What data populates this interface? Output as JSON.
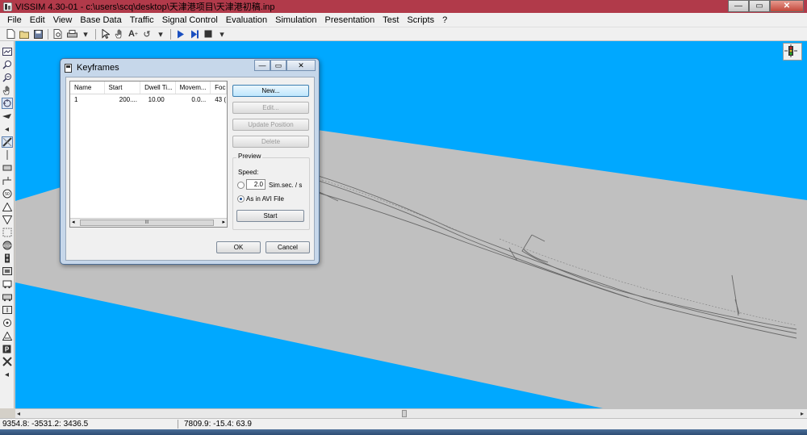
{
  "window": {
    "title": "VISSIM 4.30-01 - c:\\users\\scq\\desktop\\天津港项目\\天津港初稿.inp",
    "minimize": "—",
    "maximize": "▭",
    "close": "✕"
  },
  "menu": {
    "items": [
      {
        "label": "File",
        "enabled": true
      },
      {
        "label": "Edit",
        "enabled": true
      },
      {
        "label": "View",
        "enabled": true
      },
      {
        "label": "Base Data",
        "enabled": true
      },
      {
        "label": "Traffic",
        "enabled": true
      },
      {
        "label": "Signal Control",
        "enabled": true
      },
      {
        "label": "Evaluation",
        "enabled": true
      },
      {
        "label": "Simulation",
        "enabled": true
      },
      {
        "label": "Presentation",
        "enabled": true
      },
      {
        "label": "Test",
        "enabled": true
      },
      {
        "label": "Scripts",
        "enabled": true
      },
      {
        "label": "?",
        "enabled": true
      }
    ]
  },
  "toolbar": {
    "icons": [
      "new-file-icon",
      "open-file-icon",
      "save-icon",
      "print-preview-icon",
      "print-icon",
      "select-arrow-icon",
      "pan-hand-icon",
      "text-size-icon",
      "rotate-icon",
      "play-icon",
      "step-icon",
      "stop-icon"
    ]
  },
  "dialog": {
    "title": "Keyframes",
    "columns": [
      "Name",
      "Start",
      "Dwell Ti...",
      "Movem...",
      "Foc"
    ],
    "rows": [
      [
        "1",
        "200....",
        "10.00",
        "0.0...",
        "43 ("
      ]
    ],
    "buttons": {
      "new": "New...",
      "edit": "Edit...",
      "update_position": "Update Position",
      "delete": "Delete",
      "start": "Start",
      "ok": "OK",
      "cancel": "Cancel"
    },
    "preview": {
      "label": "Preview",
      "speed_label": "Speed:",
      "speed_value": "2.0",
      "speed_unit": "Sim.sec. / s",
      "avi_option": "As in AVI File",
      "selected": "avi"
    },
    "scroll_thumb": "III"
  },
  "status": {
    "coord_left": "9354.8: -3531.2: 3436.5",
    "coord_right": "7809.9: -15.4: 63.9"
  },
  "colors": {
    "background_sky": "#00a8ff",
    "ground": "#c0c0c0",
    "title_bar": "#b13a4a"
  }
}
